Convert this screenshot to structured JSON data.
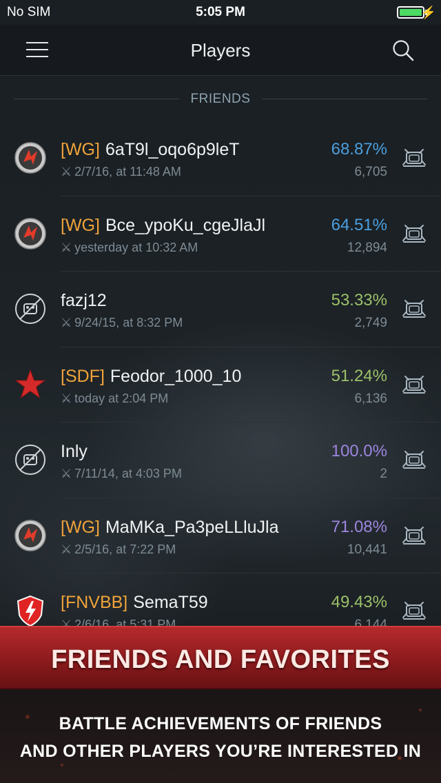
{
  "status_bar": {
    "carrier": "No SIM",
    "time": "5:05 PM",
    "battery_level": 1.0,
    "battery_color": "#4cd964"
  },
  "nav": {
    "title": "Players",
    "menu_icon": "hamburger-menu-icon",
    "search_icon": "search-icon"
  },
  "section": {
    "label": "FRIENDS"
  },
  "players": [
    {
      "avatar": "wg-logo-icon",
      "clan": "[WG]",
      "name": "6aT9l_oqo6p9leT",
      "last_battle": "2/7/16, at 11:48 AM",
      "win_rate": "68.87%",
      "win_rate_color": "#4a9fe0",
      "battles": "6,705"
    },
    {
      "avatar": "wg-logo-icon",
      "clan": "[WG]",
      "name": "Bce_ypoKu_cgeJlaJl",
      "last_battle": "yesterday at  10:32 AM",
      "win_rate": "64.51%",
      "win_rate_color": "#4a9fe0",
      "battles": "12,894"
    },
    {
      "avatar": "no-clan-icon",
      "clan": "",
      "name": "fazj12",
      "last_battle": "9/24/15, at 8:32 PM",
      "win_rate": "53.33%",
      "win_rate_color": "#9cc06a",
      "battles": "2,749"
    },
    {
      "avatar": "red-star-icon",
      "clan": "[SDF]",
      "name": "Feodor_1000_10",
      "last_battle": "today at  2:04 PM",
      "win_rate": "51.24%",
      "win_rate_color": "#9cc06a",
      "battles": "6,136"
    },
    {
      "avatar": "no-clan-icon",
      "clan": "",
      "name": "Inly",
      "last_battle": "7/11/14, at 4:03 PM",
      "win_rate": "100.0%",
      "win_rate_color": "#9d86e0",
      "battles": "2"
    },
    {
      "avatar": "wg-logo-icon",
      "clan": "[WG]",
      "name": "MaMKa_Pa3peLLluJla",
      "last_battle": "2/5/16, at 7:22 PM",
      "win_rate": "71.08%",
      "win_rate_color": "#9d86e0",
      "battles": "10,441"
    },
    {
      "avatar": "blitz-shield-icon",
      "clan": "[FNVBB]",
      "name": "SemaT59",
      "last_battle": "2/6/16, at 5:31 PM",
      "win_rate": "49.43%",
      "win_rate_color": "#9cc06a",
      "battles": "6,144"
    }
  ],
  "banner": {
    "title": "FRIENDS AND FAVORITES"
  },
  "footer": {
    "line1": "BATTLE ACHIEVEMENTS OF FRIENDS",
    "line2": "AND OTHER PLAYERS YOU’RE INTERESTED IN"
  }
}
